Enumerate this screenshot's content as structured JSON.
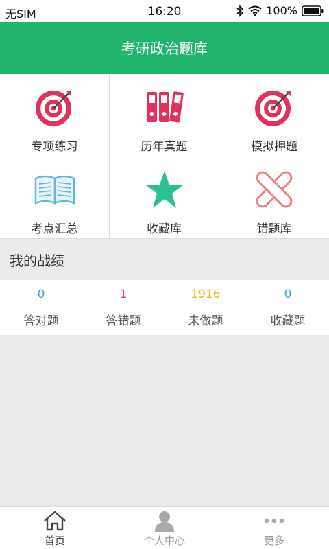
{
  "status_bar": {
    "carrier": "无SIM",
    "time": "16:20",
    "battery": "100%"
  },
  "app_bar": {
    "title": "考研政治题库"
  },
  "grid": {
    "items": [
      {
        "label": "专项练习",
        "icon": "target-icon",
        "color": "#e0325a"
      },
      {
        "label": "历年真题",
        "icon": "binders-icon",
        "color": "#e0325a"
      },
      {
        "label": "模拟押题",
        "icon": "target-icon",
        "color": "#e0325a"
      },
      {
        "label": "考点汇总",
        "icon": "open-book-icon",
        "color": "#5fb8d8"
      },
      {
        "label": "收藏库",
        "icon": "star-icon",
        "color": "#2fbf96"
      },
      {
        "label": "错题库",
        "icon": "cross-icon",
        "color": "#ee8080"
      }
    ]
  },
  "section": {
    "title": "我的战绩"
  },
  "stats": [
    {
      "value": "0",
      "label": "答对题",
      "color": "#3ea6d4"
    },
    {
      "value": "1",
      "label": "答错题",
      "color": "#e24a6a"
    },
    {
      "value": "1916",
      "label": "未做题",
      "color": "#e8b818"
    },
    {
      "value": "0",
      "label": "收藏题",
      "color": "#3ea6d4"
    }
  ],
  "bottom_nav": [
    {
      "label": "首页",
      "icon": "home-icon",
      "active": true
    },
    {
      "label": "个人中心",
      "icon": "person-icon",
      "active": false
    },
    {
      "label": "更多",
      "icon": "more-dots-icon",
      "active": false
    }
  ],
  "colors": {
    "brand_green": "#21b46c"
  }
}
